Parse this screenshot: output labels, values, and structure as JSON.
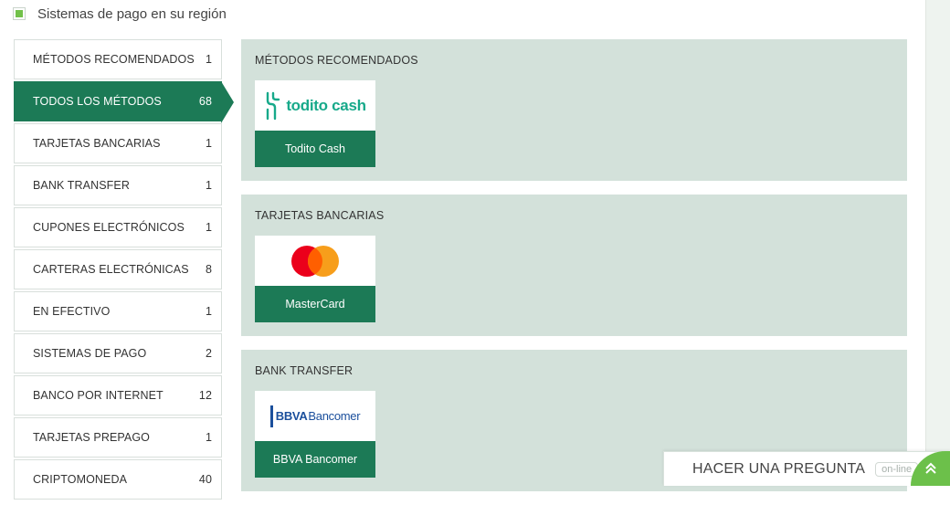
{
  "region": {
    "label": "Sistemas de pago en su región",
    "checked": true
  },
  "sidebar": {
    "items": [
      {
        "label": "MÉTODOS RECOMENDADOS",
        "count": "1"
      },
      {
        "label": "TODOS LOS MÉTODOS",
        "count": "68",
        "active": true
      },
      {
        "label": "TARJETAS BANCARIAS",
        "count": "1"
      },
      {
        "label": "BANK TRANSFER",
        "count": "1"
      },
      {
        "label": "CUPONES ELECTRÓNICOS",
        "count": "1"
      },
      {
        "label": "CARTERAS ELECTRÓNICAS",
        "count": "8"
      },
      {
        "label": "EN EFECTIVO",
        "count": "1"
      },
      {
        "label": "SISTEMAS DE PAGO",
        "count": "2"
      },
      {
        "label": "BANCO POR INTERNET",
        "count": "12"
      },
      {
        "label": "TARJETAS PREPAGO",
        "count": "1"
      },
      {
        "label": "CRIPTOMONEDA",
        "count": "40"
      }
    ]
  },
  "sections": [
    {
      "title": "MÉTODOS RECOMENDADOS",
      "card": {
        "name": "Todito Cash",
        "logo_text": "todito cash"
      }
    },
    {
      "title": "TARJETAS BANCARIAS",
      "card": {
        "name": "MasterCard"
      }
    },
    {
      "title": "BANK TRANSFER",
      "card": {
        "name": "BBVA Bancomer",
        "logo_text_1": "BBVA",
        "logo_text_2": "Bancomer"
      }
    }
  ],
  "chat": {
    "label": "HACER UNA PREGUNTA",
    "status": "on-line"
  },
  "colors": {
    "accent": "#1c7a56",
    "section_bg": "#d3e1da",
    "chat_corner": "#6cc04a"
  }
}
